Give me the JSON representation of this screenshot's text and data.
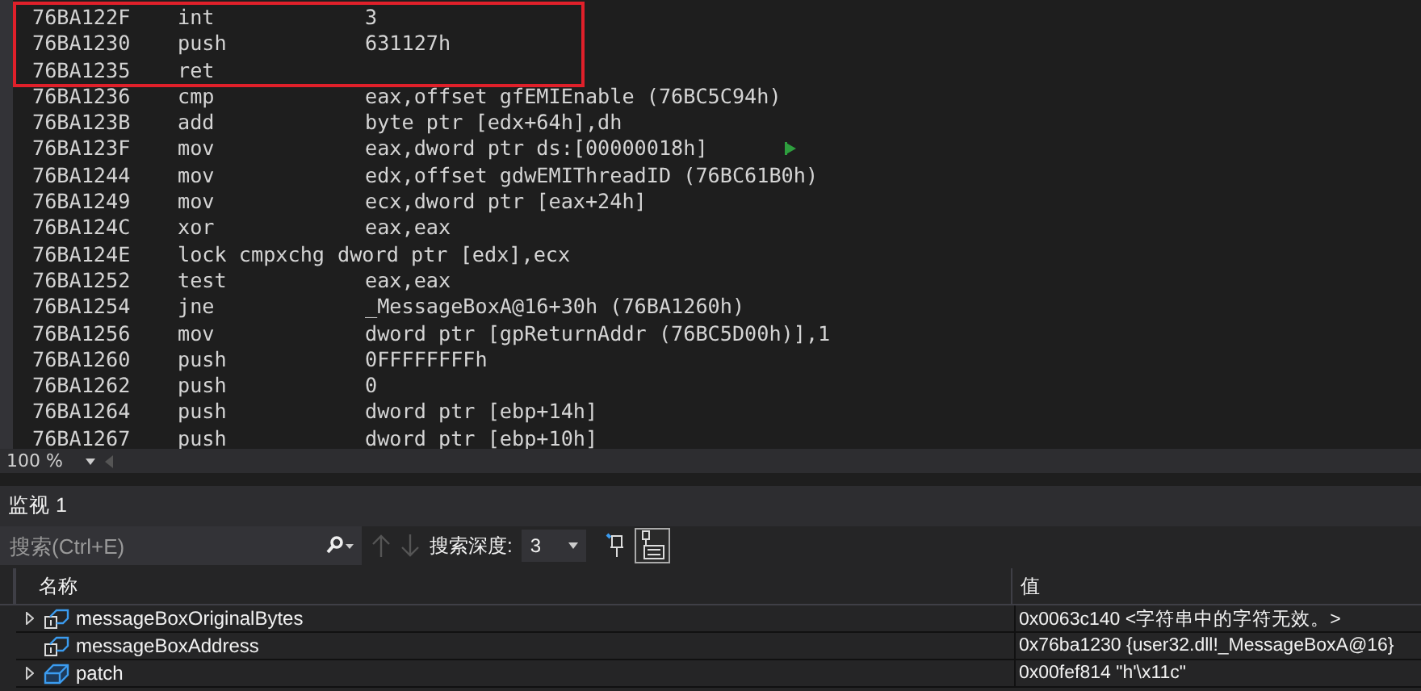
{
  "disassembly": {
    "rows": [
      {
        "address": "76BA122F",
        "mnemonic": "int",
        "operand": "3",
        "highlighted": true,
        "marker": false
      },
      {
        "address": "76BA1230",
        "mnemonic": "push",
        "operand": "631127h",
        "highlighted": true,
        "marker": false
      },
      {
        "address": "76BA1235",
        "mnemonic": "ret",
        "operand": "",
        "highlighted": true,
        "marker": false
      },
      {
        "address": "76BA1236",
        "mnemonic": "cmp",
        "operand": "eax,offset gfEMIEnable (76BC5C94h)",
        "highlighted": false,
        "marker": false
      },
      {
        "address": "76BA123B",
        "mnemonic": "add",
        "operand": "byte ptr [edx+64h],dh",
        "highlighted": false,
        "marker": false
      },
      {
        "address": "76BA123F",
        "mnemonic": "mov",
        "operand": "eax,dword ptr ds:[00000018h]",
        "highlighted": false,
        "marker": true
      },
      {
        "address": "76BA1244",
        "mnemonic": "mov",
        "operand": "edx,offset gdwEMIThreadID (76BC61B0h)",
        "highlighted": false,
        "marker": false
      },
      {
        "address": "76BA1249",
        "mnemonic": "mov",
        "operand": "ecx,dword ptr [eax+24h]",
        "highlighted": false,
        "marker": false
      },
      {
        "address": "76BA124C",
        "mnemonic": "xor",
        "operand": "eax,eax",
        "highlighted": false,
        "marker": false
      },
      {
        "address": "76BA124E",
        "mnemonic": "lock cmpxchg",
        "operand": "dword ptr [edx],ecx",
        "highlighted": false,
        "marker": false
      },
      {
        "address": "76BA1252",
        "mnemonic": "test",
        "operand": "eax,eax",
        "highlighted": false,
        "marker": false
      },
      {
        "address": "76BA1254",
        "mnemonic": "jne",
        "operand": "_MessageBoxA@16+30h (76BA1260h)",
        "highlighted": false,
        "marker": false
      },
      {
        "address": "76BA1256",
        "mnemonic": "mov",
        "operand": "dword ptr [gpReturnAddr (76BC5D00h)],1",
        "highlighted": false,
        "marker": false
      },
      {
        "address": "76BA1260",
        "mnemonic": "push",
        "operand": "0FFFFFFFFh",
        "highlighted": false,
        "marker": false
      },
      {
        "address": "76BA1262",
        "mnemonic": "push",
        "operand": "0",
        "highlighted": false,
        "marker": false
      },
      {
        "address": "76BA1264",
        "mnemonic": "push",
        "operand": "dword ptr [ebp+14h]",
        "highlighted": false,
        "marker": false
      },
      {
        "address": "76BA1267",
        "mnemonic": "push",
        "operand": "dword ptr [ebp+10h]",
        "highlighted": false,
        "marker": false
      }
    ],
    "zoom": "100 %"
  },
  "watch": {
    "title": "监视 1",
    "search": {
      "placeholder": "搜索(Ctrl+E)"
    },
    "depth_label": "搜索深度:",
    "depth_value": "3",
    "columns": [
      "名称",
      "值"
    ],
    "rows": [
      {
        "name": "messageBoxOriginalBytes",
        "value": "0x0063c140 <字符串中的字符无效。>",
        "expandable": true,
        "kind": "pointer"
      },
      {
        "name": "messageBoxAddress",
        "value": "0x76ba1230 {user32.dll!_MessageBoxA@16}",
        "expandable": false,
        "kind": "pointer"
      },
      {
        "name": "patch",
        "value": "0x00fef814 \"h'\\x11c\"",
        "expandable": true,
        "kind": "object"
      }
    ]
  }
}
